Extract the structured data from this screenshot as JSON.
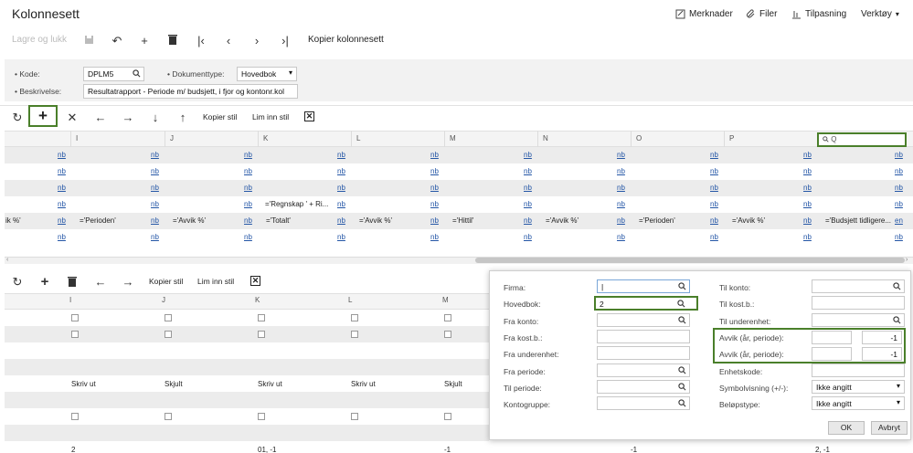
{
  "title": "Kolonnesett",
  "top_actions": {
    "merknader": "Merknader",
    "filer": "Filer",
    "tilpasning": "Tilpasning",
    "verktoy": "Verktøy"
  },
  "toolbar": {
    "save_close": "Lagre og lukk",
    "copy_set": "Kopier kolonnesett"
  },
  "form": {
    "kode_label": "Kode:",
    "kode_value": "DPLM5",
    "doktype_label": "Dokumenttype:",
    "doktype_value": "Hovedbok",
    "beskr_label": "Beskrivelse:",
    "beskr_value": "Resultatrapport - Periode m/ budsjett, i fjor og kontonr.kol"
  },
  "grid_toolbar": {
    "copy_style": "Kopier stil",
    "paste_style": "Lim inn stil"
  },
  "grid": {
    "columns": [
      "I",
      "J",
      "K",
      "L",
      "M",
      "N",
      "O",
      "P",
      "Q"
    ],
    "nb": "nb",
    "en": "en",
    "row4_k": "='Regnskap ' + Ri...",
    "row5_start": "ik %'",
    "row5_cells": [
      "='Perioden'",
      "='Avvik %'",
      "='Totalt'",
      "='Avvik %'",
      "='Hittil'",
      "='Avvik %'",
      "='Perioden'",
      "='Avvik %'",
      "='Budsjett tidligere..."
    ]
  },
  "lower_toolbar": {
    "copy_style": "Kopier stil",
    "paste_style": "Lim inn stil"
  },
  "lower_grid": {
    "columns": [
      "I",
      "J",
      "K",
      "L",
      "M"
    ],
    "row_labels": [
      "Skriv ut",
      "Skjult",
      "Skriv ut",
      "Skriv ut",
      "Skjult"
    ],
    "bottom": [
      "2",
      "01, -1",
      "-1",
      "-1",
      "2, -1"
    ]
  },
  "popup": {
    "firma_label": "Firma:",
    "firma_value": "|",
    "hovedbok_label": "Hovedbok:",
    "hovedbok_value": "2",
    "frakonto_label": "Fra konto:",
    "frakost_label": "Fra kost.b.:",
    "fraunder_label": "Fra underenhet:",
    "fraperiode_label": "Fra periode:",
    "tilperiode_label": "Til periode:",
    "kontogruppe_label": "Kontogruppe:",
    "tilkonto_label": "Til konto:",
    "tilkost_label": "Til kost.b.:",
    "tilunder_label": "Til underenhet:",
    "avvik1_label": "Avvik (år, periode):",
    "avvik1_value": "-1",
    "avvik2_label": "Avvik (år, periode):",
    "avvik2_value": "-1",
    "enhetskode_label": "Enhetskode:",
    "symbol_label": "Symbolvisning (+/-):",
    "symbol_value": "Ikke angitt",
    "belop_label": "Beløpstype:",
    "belop_value": "Ikke angitt",
    "ok": "OK",
    "cancel": "Avbryt"
  },
  "colors": {
    "highlight": "#4a7f2a",
    "link": "#2456a6"
  }
}
